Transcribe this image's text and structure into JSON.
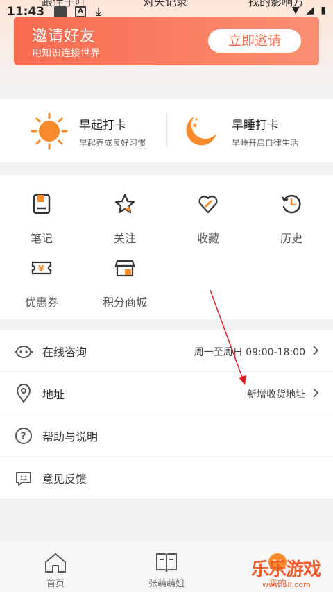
{
  "status_bar": {
    "time": "11:43",
    "clip_left": "跟伴于叮",
    "clip_mid": "对失记录",
    "clip_right": "找的影响方"
  },
  "invite": {
    "title": "邀请好友",
    "subtitle": "用知识连接世界",
    "button": "立即邀请"
  },
  "checkin": [
    {
      "title": "早起打卡",
      "subtitle": "早起养成良好习惯",
      "icon": "sun-icon"
    },
    {
      "title": "早睡打卡",
      "subtitle": "早睡开启自律生活",
      "icon": "moon-icon"
    }
  ],
  "grid": [
    {
      "label": "笔记",
      "icon": "note-icon"
    },
    {
      "label": "关注",
      "icon": "star-icon"
    },
    {
      "label": "收藏",
      "icon": "heart-icon"
    },
    {
      "label": "历史",
      "icon": "history-icon"
    },
    {
      "label": "优惠券",
      "icon": "coupon-icon"
    },
    {
      "label": "积分商城",
      "icon": "shop-icon"
    }
  ],
  "list": [
    {
      "label": "在线咨询",
      "value": "周一至周日 09:00-18:00",
      "icon": "chat-bot-icon"
    },
    {
      "label": "地址",
      "value": "新增收货地址",
      "icon": "location-icon"
    },
    {
      "label": "帮助与说明",
      "value": "",
      "icon": "help-icon"
    },
    {
      "label": "意见反馈",
      "value": "",
      "icon": "feedback-icon"
    }
  ],
  "nav": [
    {
      "label": "首页",
      "icon": "home-icon"
    },
    {
      "label": "张萌萌姐",
      "icon": "book-icon"
    },
    {
      "label": "我的",
      "icon": "profile-icon"
    }
  ],
  "watermark": {
    "text": "乐乐游戏",
    "url": "www.6ll.com"
  },
  "colors": {
    "accent": "#f46d4f",
    "orange": "#f98a2c",
    "annotation": "#e02020"
  }
}
